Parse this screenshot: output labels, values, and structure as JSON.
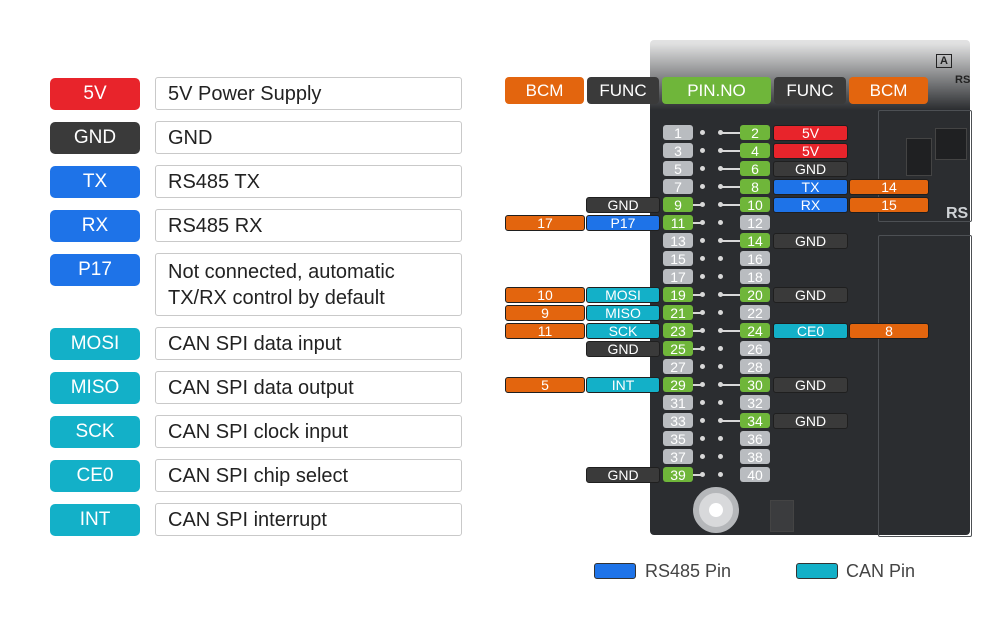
{
  "colors": {
    "power": "#e8242b",
    "ground": "#3a3a3a",
    "rs485": "#1e73e8",
    "can": "#13b0c8",
    "bcm": "#e3650e",
    "pin_active": "#6fb63a",
    "pin_inactive": "#b9bcc0"
  },
  "legend": [
    {
      "tag": "5V",
      "color": "#e8242b",
      "desc": "5V Power Supply"
    },
    {
      "tag": "GND",
      "color": "#3a3a3a",
      "desc": "GND"
    },
    {
      "tag": "TX",
      "color": "#1e73e8",
      "desc": "RS485 TX"
    },
    {
      "tag": "RX",
      "color": "#1e73e8",
      "desc": "RS485 RX"
    },
    {
      "tag": "P17",
      "color": "#1e73e8",
      "desc": "Not connected, automatic TX/RX control by default"
    },
    {
      "tag": "MOSI",
      "color": "#13b0c8",
      "desc": "CAN SPI data input"
    },
    {
      "tag": "MISO",
      "color": "#13b0c8",
      "desc": "CAN SPI data output"
    },
    {
      "tag": "SCK",
      "color": "#13b0c8",
      "desc": "CAN SPI clock input"
    },
    {
      "tag": "CE0",
      "color": "#13b0c8",
      "desc": "CAN SPI chip select"
    },
    {
      "tag": "INT",
      "color": "#13b0c8",
      "desc": "CAN SPI interrupt"
    }
  ],
  "header": {
    "bcm_left": "BCM",
    "func_left": "FUNC",
    "pin_no": "PIN.NO",
    "func_right": "FUNC",
    "bcm_right": "BCM"
  },
  "pins": [
    {
      "odd": 1,
      "even": 2,
      "odd_on": false,
      "even_on": true,
      "left": null,
      "right": {
        "func": "5V",
        "fc": "#e8242b"
      }
    },
    {
      "odd": 3,
      "even": 4,
      "odd_on": false,
      "even_on": true,
      "left": null,
      "right": {
        "func": "5V",
        "fc": "#e8242b"
      }
    },
    {
      "odd": 5,
      "even": 6,
      "odd_on": false,
      "even_on": true,
      "left": null,
      "right": {
        "func": "GND",
        "fc": "#3a3a3a"
      }
    },
    {
      "odd": 7,
      "even": 8,
      "odd_on": false,
      "even_on": true,
      "left": null,
      "right": {
        "func": "TX",
        "fc": "#1e73e8",
        "bcm": "14"
      }
    },
    {
      "odd": 9,
      "even": 10,
      "odd_on": true,
      "even_on": true,
      "left": {
        "func": "GND",
        "fc": "#3a3a3a"
      },
      "right": {
        "func": "RX",
        "fc": "#1e73e8",
        "bcm": "15"
      }
    },
    {
      "odd": 11,
      "even": 12,
      "odd_on": true,
      "even_on": false,
      "left": {
        "func": "P17",
        "fc": "#1e73e8",
        "bcm": "17"
      },
      "right": null
    },
    {
      "odd": 13,
      "even": 14,
      "odd_on": false,
      "even_on": true,
      "left": null,
      "right": {
        "func": "GND",
        "fc": "#3a3a3a"
      }
    },
    {
      "odd": 15,
      "even": 16,
      "odd_on": false,
      "even_on": false,
      "left": null,
      "right": null
    },
    {
      "odd": 17,
      "even": 18,
      "odd_on": false,
      "even_on": false,
      "left": null,
      "right": null
    },
    {
      "odd": 19,
      "even": 20,
      "odd_on": true,
      "even_on": true,
      "left": {
        "func": "MOSI",
        "fc": "#13b0c8",
        "bcm": "10"
      },
      "right": {
        "func": "GND",
        "fc": "#3a3a3a"
      }
    },
    {
      "odd": 21,
      "even": 22,
      "odd_on": true,
      "even_on": false,
      "left": {
        "func": "MISO",
        "fc": "#13b0c8",
        "bcm": "9"
      },
      "right": null
    },
    {
      "odd": 23,
      "even": 24,
      "odd_on": true,
      "even_on": true,
      "left": {
        "func": "SCK",
        "fc": "#13b0c8",
        "bcm": "11"
      },
      "right": {
        "func": "CE0",
        "fc": "#13b0c8",
        "bcm": "8"
      }
    },
    {
      "odd": 25,
      "even": 26,
      "odd_on": true,
      "even_on": false,
      "left": {
        "func": "GND",
        "fc": "#3a3a3a"
      },
      "right": null
    },
    {
      "odd": 27,
      "even": 28,
      "odd_on": false,
      "even_on": false,
      "left": null,
      "right": null
    },
    {
      "odd": 29,
      "even": 30,
      "odd_on": true,
      "even_on": true,
      "left": {
        "func": "INT",
        "fc": "#13b0c8",
        "bcm": "5"
      },
      "right": {
        "func": "GND",
        "fc": "#3a3a3a"
      }
    },
    {
      "odd": 31,
      "even": 32,
      "odd_on": false,
      "even_on": false,
      "left": null,
      "right": null
    },
    {
      "odd": 33,
      "even": 34,
      "odd_on": false,
      "even_on": true,
      "left": null,
      "right": {
        "func": "GND",
        "fc": "#3a3a3a"
      }
    },
    {
      "odd": 35,
      "even": 36,
      "odd_on": false,
      "even_on": false,
      "left": null,
      "right": null
    },
    {
      "odd": 37,
      "even": 38,
      "odd_on": false,
      "even_on": false,
      "left": null,
      "right": null
    },
    {
      "odd": 39,
      "even": 40,
      "odd_on": true,
      "even_on": false,
      "left": {
        "func": "GND",
        "fc": "#3a3a3a"
      },
      "right": null
    }
  ],
  "board_silk": {
    "a": "A",
    "rs_top": "RS",
    "rs_side": "RS"
  },
  "key": {
    "rs485_label": "RS485 Pin",
    "can_label": "CAN Pin"
  }
}
